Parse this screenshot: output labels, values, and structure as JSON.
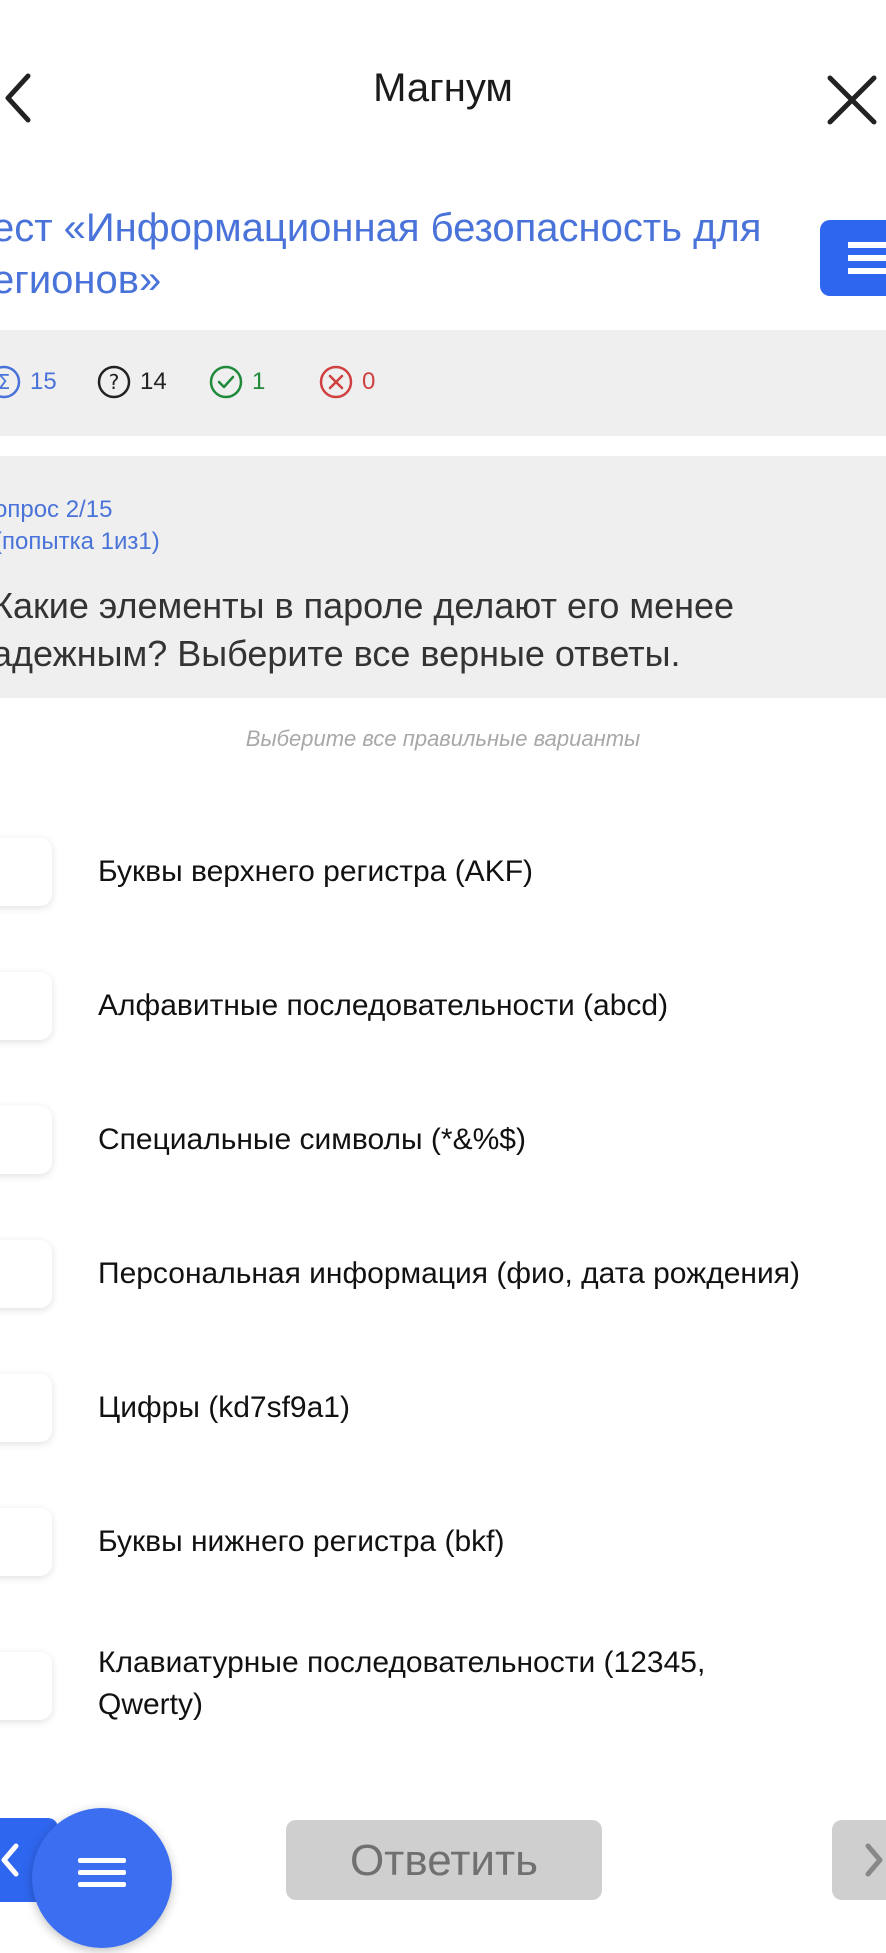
{
  "header": {
    "title": "Магнум"
  },
  "test": {
    "title_line1": "ест «Информационная безопасность для",
    "title_line2": "егионов»"
  },
  "stats": {
    "total": "15",
    "unanswered": "14",
    "correct": "1",
    "wrong": "0",
    "colors": {
      "total": "#4a73d9",
      "unanswered": "#222222",
      "correct": "#1f8a3a",
      "wrong": "#d04040"
    }
  },
  "question": {
    "number": "опрос 2/15",
    "attempt": "(попытка 1из1)",
    "text_line1": "Какие элементы в пароле делают его менее",
    "text_line2": "адежным? Выберите все верные ответы.",
    "hint": "Выберите все правильные варианты"
  },
  "options": [
    {
      "label": "Буквы верхнего регистра (AKF)"
    },
    {
      "label": "Алфавитные последовательности (abcd)"
    },
    {
      "label": "Специальные символы (*&%$)"
    },
    {
      "label": "Персональная информация (фио, дата рождения)"
    },
    {
      "label": "Цифры (kd7sf9a1)"
    },
    {
      "label": "Буквы нижнего регистра (bkf)"
    },
    {
      "label_line1": "Клавиатурные последовательности (12345,",
      "label_line2": "Qwerty)"
    }
  ],
  "footer": {
    "answer_label": "Ответить"
  },
  "accent_color": "#2f66ef"
}
